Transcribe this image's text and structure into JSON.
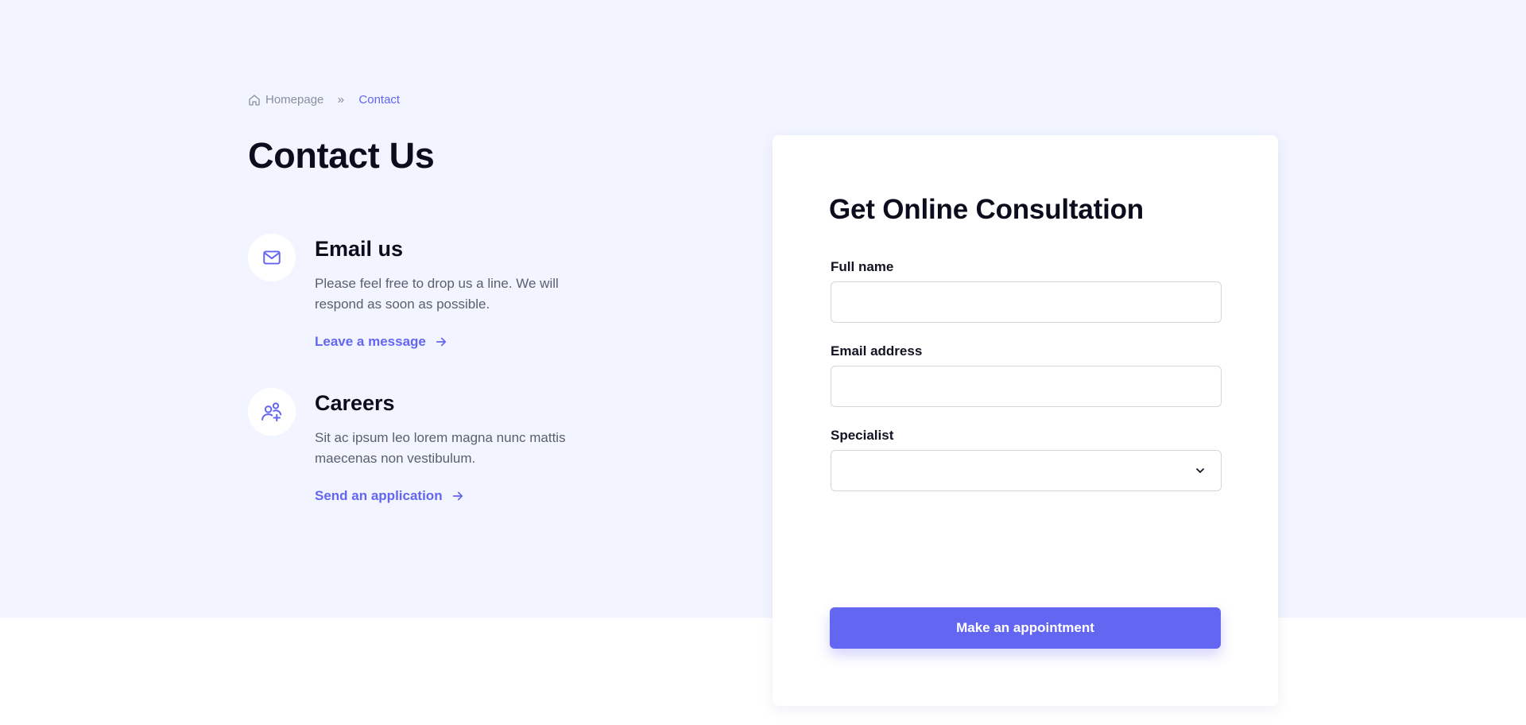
{
  "breadcrumb": {
    "home_label": "Homepage",
    "current_label": "Contact"
  },
  "page_title": "Contact Us",
  "info_blocks": [
    {
      "title": "Email us",
      "description": "Please feel free to drop us a line. We will respond as soon as possible.",
      "link_label": "Leave a message",
      "icon": "mail-icon"
    },
    {
      "title": "Careers",
      "description": "Sit ac ipsum leo lorem magna nunc mattis maecenas non vestibulum.",
      "link_label": "Send an application",
      "icon": "user-plus-icon"
    }
  ],
  "form": {
    "title": "Get Online Consultation",
    "full_name": {
      "label": "Full name",
      "value": ""
    },
    "email": {
      "label": "Email address",
      "value": ""
    },
    "specialist": {
      "label": "Specialist",
      "selected": ""
    },
    "submit_label": "Make an appointment"
  },
  "colors": {
    "accent": "#6366f1",
    "hero_background": "#f2f5ff",
    "heading": "#0b0d1c",
    "body_text": "#5a5f6e"
  }
}
